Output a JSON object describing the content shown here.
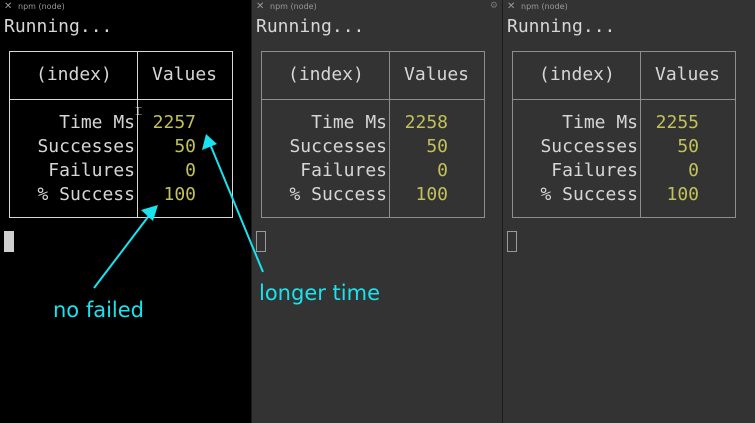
{
  "tab_title": "npm (node)",
  "close_glyph": "✕",
  "settings_glyph": "⚙",
  "ibeam_glyph": "⌶",
  "status": "Running...",
  "table": {
    "index_header": "(index)",
    "values_header": "Values"
  },
  "row_labels": [
    "Time Ms",
    "Successes",
    "Failures",
    "% Success"
  ],
  "panes": [
    {
      "values": [
        "2257",
        "50",
        "0",
        "100"
      ],
      "cursor": "solid"
    },
    {
      "values": [
        "2258",
        "50",
        "0",
        "100"
      ],
      "cursor": "hollow"
    },
    {
      "values": [
        "2255",
        "50",
        "0",
        "100"
      ],
      "cursor": "hollow"
    }
  ],
  "annotations": {
    "no_failed": "no failed",
    "longer_time": "longer time",
    "color": "#19e3ef"
  },
  "colors": {
    "value_text": "#c2c05a",
    "terminal_text": "#d6d6d6",
    "focused_pane_bg": "#000000",
    "pane_bg": "#333333"
  }
}
